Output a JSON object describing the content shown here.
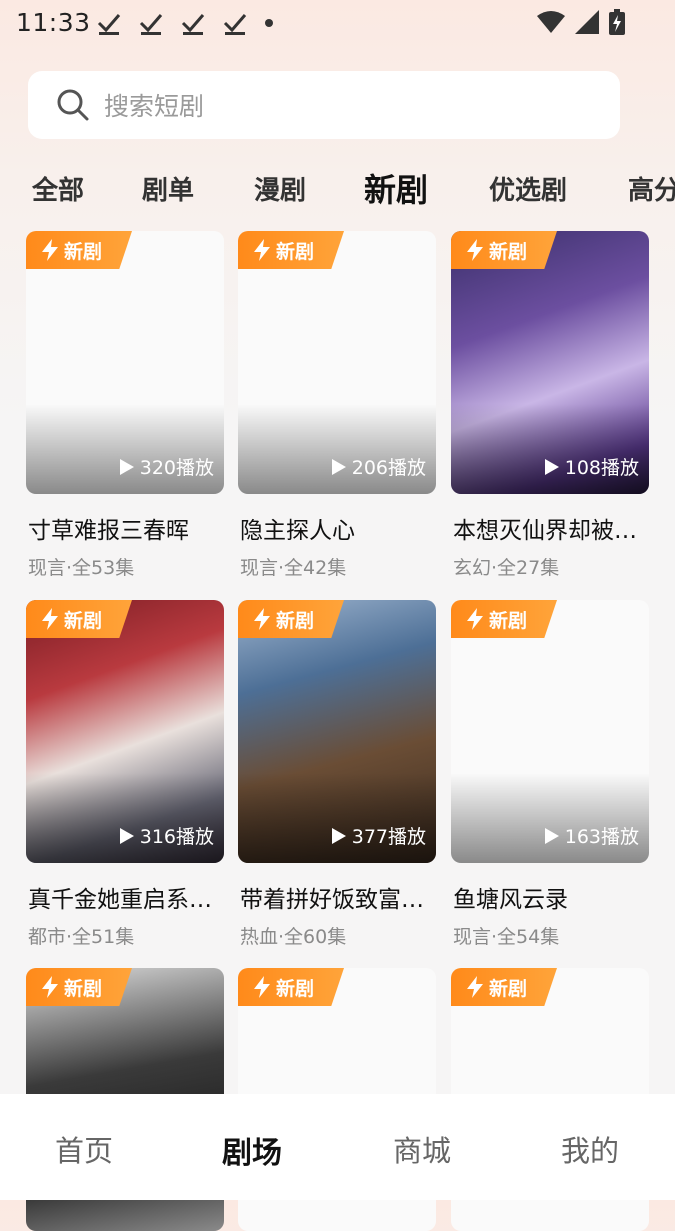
{
  "status_bar": {
    "time": "11:33"
  },
  "search": {
    "placeholder": "搜索短剧"
  },
  "tabs": [
    "全部",
    "剧单",
    "漫剧",
    "新剧",
    "优选剧",
    "高分"
  ],
  "active_tab": "新剧",
  "badge_label": "新剧",
  "cards": [
    {
      "title": "寸草难报三春晖",
      "meta": "现言·全53集",
      "plays": "320播放"
    },
    {
      "title": "隐主探人心",
      "meta": "现言·全42集",
      "plays": "206播放"
    },
    {
      "title": "本想灭仙界却被…",
      "meta": "玄幻·全27集",
      "plays": "108播放"
    },
    {
      "title": "真千金她重启系…",
      "meta": "都市·全51集",
      "plays": "316播放"
    },
    {
      "title": "带着拼好饭致富…",
      "meta": "热血·全60集",
      "plays": "377播放"
    },
    {
      "title": "鱼塘风云录",
      "meta": "现言·全54集",
      "plays": "163播放"
    }
  ],
  "bottom_nav": [
    "首页",
    "剧场",
    "商城",
    "我的"
  ],
  "colors": {
    "badge": "#ff8a1a",
    "background": "#f6f5f5"
  }
}
